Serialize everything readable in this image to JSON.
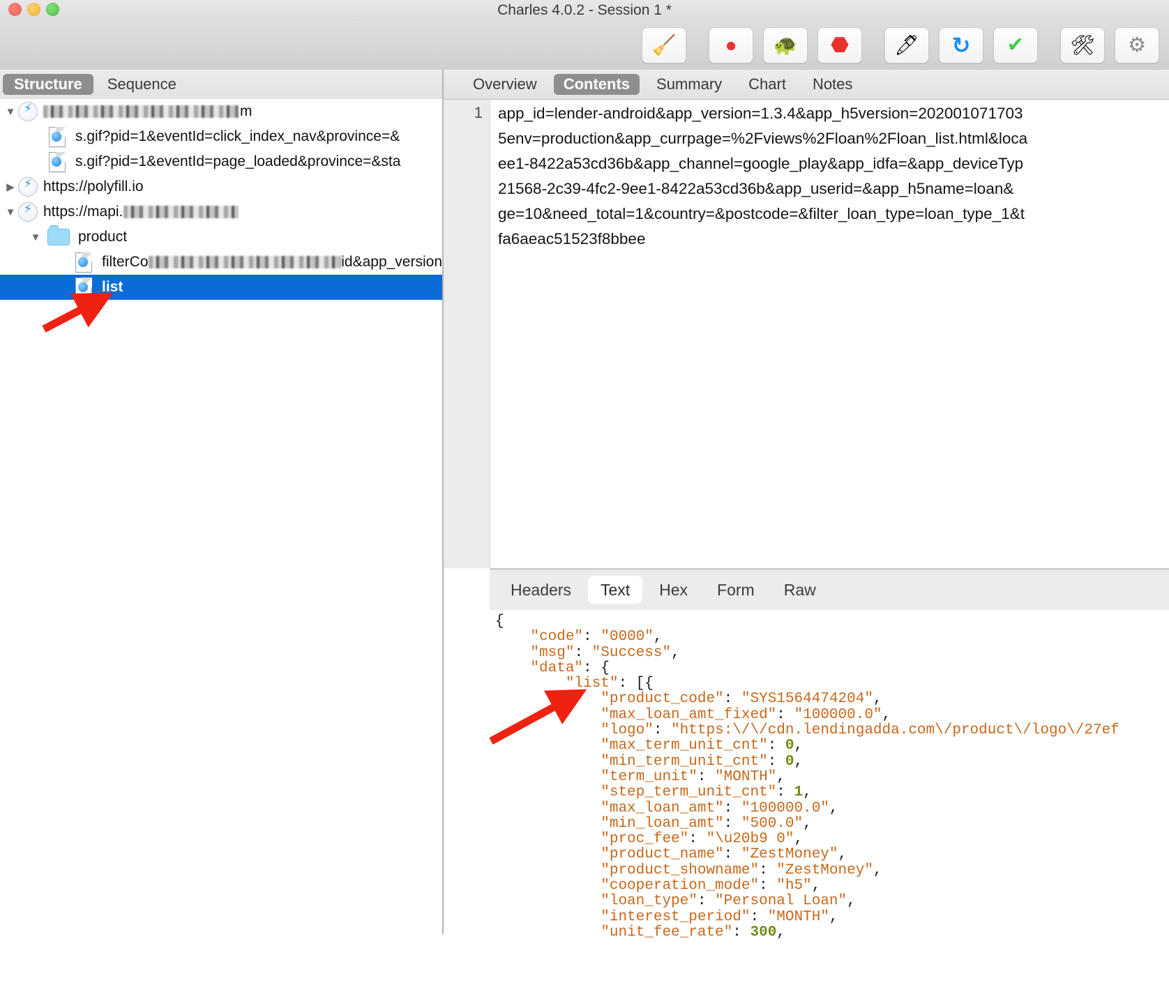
{
  "window": {
    "title": "Charles 4.0.2 - Session 1 *",
    "traffic_lights": [
      "close-button",
      "minimize-button",
      "zoom-button"
    ]
  },
  "toolbar": {
    "groups": [
      [
        {
          "name": "clear-session-button",
          "glyph": "🧹"
        }
      ],
      [
        {
          "name": "start-stop-recording-button",
          "glyph": "⏺"
        },
        {
          "name": "throttle-button",
          "glyph": "🐢"
        },
        {
          "name": "breakpoints-button",
          "glyph": "⬣"
        }
      ],
      [
        {
          "name": "compose-button",
          "glyph": "🖊"
        },
        {
          "name": "repeat-button",
          "glyph": "↻"
        },
        {
          "name": "validate-button",
          "glyph": "✔"
        }
      ],
      [
        {
          "name": "tools-button",
          "glyph": "🛠"
        },
        {
          "name": "settings-button",
          "glyph": "⚙"
        }
      ]
    ]
  },
  "left_panel": {
    "tabs": [
      {
        "label": "Structure",
        "active": true
      },
      {
        "label": "Sequence",
        "active": false
      }
    ],
    "tree": [
      {
        "depth": 0,
        "twisty": "▼",
        "icon": "bolt-icon",
        "label": "",
        "redacted": true,
        "redact_width": 280,
        "suffix": "m"
      },
      {
        "depth": 1,
        "twisty": "",
        "icon": "doc-icon",
        "label": "s.gif?pid=1&eventId=click_index_nav&province=&",
        "redacted": false
      },
      {
        "depth": 1,
        "twisty": "",
        "icon": "doc-icon",
        "label": "s.gif?pid=1&eventId=page_loaded&province=&sta",
        "redacted": false
      },
      {
        "depth": 0,
        "twisty": "▶",
        "icon": "bolt-icon",
        "label": "https://polyfill.io",
        "redacted": false
      },
      {
        "depth": 0,
        "twisty": "▼",
        "icon": "bolt-icon",
        "label": "https://mapi.",
        "redacted": true,
        "redact_width": 165,
        "suffix": ""
      },
      {
        "depth": 1,
        "twisty": "▼",
        "icon": "folder-icon",
        "label": "product",
        "redacted": false
      },
      {
        "depth": 2,
        "twisty": "",
        "icon": "doc-icon",
        "label": "filterCo",
        "redacted": true,
        "redact_width": 300,
        "suffix": "id&app_version"
      },
      {
        "depth": 2,
        "twisty": "",
        "icon": "doc-icon",
        "label": "list",
        "redacted": false,
        "selected": true
      }
    ]
  },
  "right_panel": {
    "tabs": [
      {
        "label": "Overview",
        "active": false
      },
      {
        "label": "Contents",
        "active": true
      },
      {
        "label": "Summary",
        "active": false
      },
      {
        "label": "Chart",
        "active": false
      },
      {
        "label": "Notes",
        "active": false
      }
    ],
    "request": {
      "line_number": "1",
      "body": "app_id=lender-android&app_version=1.3.4&app_h5version=202001071703\n5env=production&app_currpage=%2Fviews%2Floan%2Floan_list.html&loca\nee1-8422a53cd36b&app_channel=google_play&app_idfa=&app_deviceTyp\n21568-2c39-4fc2-9ee1-8422a53cd36b&app_userid=&app_h5name=loan&\nge=10&need_total=1&country=&postcode=&filter_loan_type=loan_type_1&t\nfa6aeac51523f8bbee"
    },
    "bottom_tabs": [
      {
        "label": "Headers",
        "active": false
      },
      {
        "label": "Text",
        "active": true
      },
      {
        "label": "Hex",
        "active": false
      },
      {
        "label": "Form",
        "active": false
      },
      {
        "label": "Raw",
        "active": false
      }
    ],
    "response_json": [
      {
        "indent": 0,
        "tokens": [
          {
            "t": "{",
            "c": "p"
          }
        ]
      },
      {
        "indent": 1,
        "tokens": [
          {
            "t": "\"code\"",
            "c": "k"
          },
          {
            "t": ": ",
            "c": "p"
          },
          {
            "t": "\"0000\"",
            "c": "s"
          },
          {
            "t": ",",
            "c": "p"
          }
        ]
      },
      {
        "indent": 1,
        "tokens": [
          {
            "t": "\"msg\"",
            "c": "k"
          },
          {
            "t": ": ",
            "c": "p"
          },
          {
            "t": "\"Success\"",
            "c": "s"
          },
          {
            "t": ",",
            "c": "p"
          }
        ]
      },
      {
        "indent": 1,
        "tokens": [
          {
            "t": "\"data\"",
            "c": "k"
          },
          {
            "t": ": ",
            "c": "p"
          },
          {
            "t": "{",
            "c": "p"
          }
        ]
      },
      {
        "indent": 2,
        "tokens": [
          {
            "t": "\"list\"",
            "c": "k"
          },
          {
            "t": ": ",
            "c": "p"
          },
          {
            "t": "[{",
            "c": "p"
          }
        ]
      },
      {
        "indent": 3,
        "tokens": [
          {
            "t": "\"product_code\"",
            "c": "k"
          },
          {
            "t": ": ",
            "c": "p"
          },
          {
            "t": "\"SYS1564474204\"",
            "c": "s"
          },
          {
            "t": ",",
            "c": "p"
          }
        ]
      },
      {
        "indent": 3,
        "tokens": [
          {
            "t": "\"max_loan_amt_fixed\"",
            "c": "k"
          },
          {
            "t": ": ",
            "c": "p"
          },
          {
            "t": "\"100000.0\"",
            "c": "s"
          },
          {
            "t": ",",
            "c": "p"
          }
        ]
      },
      {
        "indent": 3,
        "tokens": [
          {
            "t": "\"logo\"",
            "c": "k"
          },
          {
            "t": ": ",
            "c": "p"
          },
          {
            "t": "\"https:\\/\\/cdn.lendingadda.com\\/product\\/logo\\/27ef",
            "c": "s"
          }
        ]
      },
      {
        "indent": 3,
        "tokens": [
          {
            "t": "\"max_term_unit_cnt\"",
            "c": "k"
          },
          {
            "t": ": ",
            "c": "p"
          },
          {
            "t": "0",
            "c": "n"
          },
          {
            "t": ",",
            "c": "p"
          }
        ]
      },
      {
        "indent": 3,
        "tokens": [
          {
            "t": "\"min_term_unit_cnt\"",
            "c": "k"
          },
          {
            "t": ": ",
            "c": "p"
          },
          {
            "t": "0",
            "c": "n"
          },
          {
            "t": ",",
            "c": "p"
          }
        ]
      },
      {
        "indent": 3,
        "tokens": [
          {
            "t": "\"term_unit\"",
            "c": "k"
          },
          {
            "t": ": ",
            "c": "p"
          },
          {
            "t": "\"MONTH\"",
            "c": "s"
          },
          {
            "t": ",",
            "c": "p"
          }
        ]
      },
      {
        "indent": 3,
        "tokens": [
          {
            "t": "\"step_term_unit_cnt\"",
            "c": "k"
          },
          {
            "t": ": ",
            "c": "p"
          },
          {
            "t": "1",
            "c": "n"
          },
          {
            "t": ",",
            "c": "p"
          }
        ]
      },
      {
        "indent": 3,
        "tokens": [
          {
            "t": "\"max_loan_amt\"",
            "c": "k"
          },
          {
            "t": ": ",
            "c": "p"
          },
          {
            "t": "\"100000.0\"",
            "c": "s"
          },
          {
            "t": ",",
            "c": "p"
          }
        ]
      },
      {
        "indent": 3,
        "tokens": [
          {
            "t": "\"min_loan_amt\"",
            "c": "k"
          },
          {
            "t": ": ",
            "c": "p"
          },
          {
            "t": "\"500.0\"",
            "c": "s"
          },
          {
            "t": ",",
            "c": "p"
          }
        ]
      },
      {
        "indent": 3,
        "tokens": [
          {
            "t": "\"proc_fee\"",
            "c": "k"
          },
          {
            "t": ": ",
            "c": "p"
          },
          {
            "t": "\"\\u20b9 0\"",
            "c": "s"
          },
          {
            "t": ",",
            "c": "p"
          }
        ]
      },
      {
        "indent": 3,
        "tokens": [
          {
            "t": "\"product_name\"",
            "c": "k"
          },
          {
            "t": ": ",
            "c": "p"
          },
          {
            "t": "\"ZestMoney\"",
            "c": "s"
          },
          {
            "t": ",",
            "c": "p"
          }
        ]
      },
      {
        "indent": 3,
        "tokens": [
          {
            "t": "\"product_showname\"",
            "c": "k"
          },
          {
            "t": ": ",
            "c": "p"
          },
          {
            "t": "\"ZestMoney\"",
            "c": "s"
          },
          {
            "t": ",",
            "c": "p"
          }
        ]
      },
      {
        "indent": 3,
        "tokens": [
          {
            "t": "\"cooperation_mode\"",
            "c": "k"
          },
          {
            "t": ": ",
            "c": "p"
          },
          {
            "t": "\"h5\"",
            "c": "s"
          },
          {
            "t": ",",
            "c": "p"
          }
        ]
      },
      {
        "indent": 3,
        "tokens": [
          {
            "t": "\"loan_type\"",
            "c": "k"
          },
          {
            "t": ": ",
            "c": "p"
          },
          {
            "t": "\"Personal Loan\"",
            "c": "s"
          },
          {
            "t": ",",
            "c": "p"
          }
        ]
      },
      {
        "indent": 3,
        "tokens": [
          {
            "t": "\"interest_period\"",
            "c": "k"
          },
          {
            "t": ": ",
            "c": "p"
          },
          {
            "t": "\"MONTH\"",
            "c": "s"
          },
          {
            "t": ",",
            "c": "p"
          }
        ]
      },
      {
        "indent": 3,
        "tokens": [
          {
            "t": "\"unit_fee_rate\"",
            "c": "k"
          },
          {
            "t": ": ",
            "c": "p"
          },
          {
            "t": "300",
            "c": "n"
          },
          {
            "t": ",",
            "c": "p"
          }
        ]
      }
    ]
  },
  "annotations": {
    "arrow_color": "#ee2211",
    "arrows": [
      {
        "name": "annotation-arrow-tree",
        "points_to": "list"
      },
      {
        "name": "annotation-arrow-json",
        "points_to": "min_term_unit_cnt"
      }
    ]
  },
  "colors": {
    "selection_blue": "#0a6cd8",
    "json_string": "#c8671a",
    "json_number": "#6f8a18",
    "tab_active": "#8e8e8e"
  }
}
